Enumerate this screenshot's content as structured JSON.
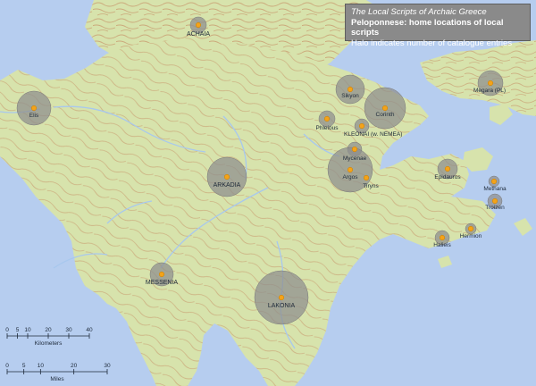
{
  "title": {
    "line1": "The Local Scripts of Archaic Greece",
    "line2": "Peloponnese: home locations of local scripts",
    "line3": "Halo indicates number of catalogue entries"
  },
  "colors": {
    "sea": "#b6cdef",
    "land": "#d7e3ac",
    "contour": "#c9a073",
    "river": "#a8c8ee",
    "halo": "#8e8e8e",
    "site_marker": "#f3a31a"
  },
  "sites": [
    {
      "name": "ACHAIA",
      "kind": "region"
    },
    {
      "name": "Elis",
      "kind": "city"
    },
    {
      "name": "Sikyon",
      "kind": "city"
    },
    {
      "name": "Corinth",
      "kind": "city"
    },
    {
      "name": "Phleious",
      "kind": "city"
    },
    {
      "name": "KLEONAI (w. NEMEA)",
      "kind": "city"
    },
    {
      "name": "Mycenae",
      "kind": "city"
    },
    {
      "name": "Argos",
      "kind": "city"
    },
    {
      "name": "Tiryns",
      "kind": "city"
    },
    {
      "name": "ARKADIA",
      "kind": "region"
    },
    {
      "name": "Megara (PL)",
      "kind": "city"
    },
    {
      "name": "Epidauros",
      "kind": "city"
    },
    {
      "name": "Methana",
      "kind": "city"
    },
    {
      "name": "Troizen",
      "kind": "city"
    },
    {
      "name": "Hermion",
      "kind": "city"
    },
    {
      "name": "Halieis",
      "kind": "city"
    },
    {
      "name": "MESSENIA",
      "kind": "region"
    },
    {
      "name": "LAKONIA",
      "kind": "region"
    }
  ],
  "scale": {
    "km_ticks": [
      "0",
      "5",
      "10",
      "20",
      "30",
      "40"
    ],
    "km_unit": "Kilometers",
    "mi_ticks": [
      "0",
      "5",
      "10",
      "20",
      "30"
    ],
    "mi_unit": "Miles"
  }
}
